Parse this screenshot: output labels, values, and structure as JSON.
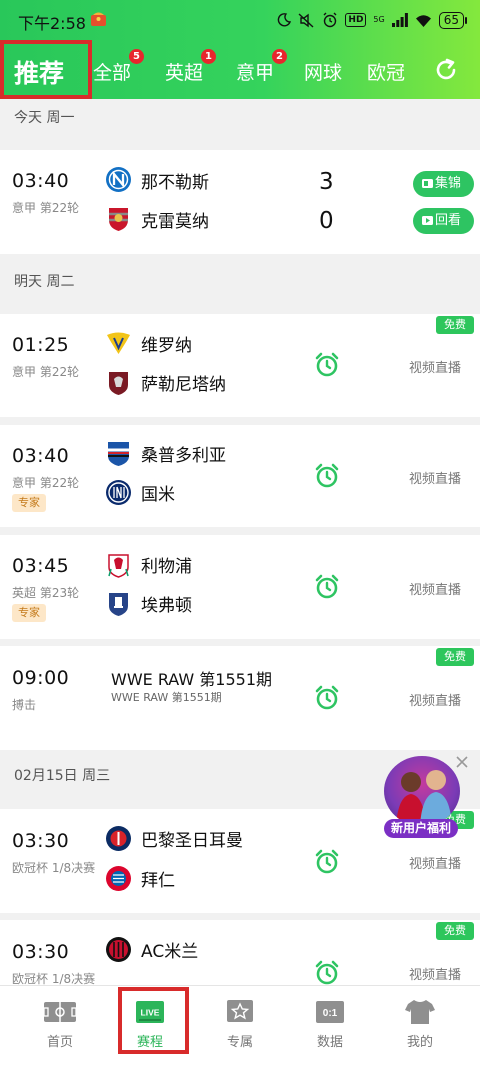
{
  "status_bar": {
    "time": "下午2:58",
    "network": "5G",
    "hd": "HD",
    "battery": "65"
  },
  "tabs": [
    {
      "label": "推荐",
      "badge": ""
    },
    {
      "label": "全部",
      "badge": "5"
    },
    {
      "label": "英超",
      "badge": "1"
    },
    {
      "label": "意甲",
      "badge": "2"
    },
    {
      "label": "网球",
      "badge": ""
    },
    {
      "label": "欧冠",
      "badge": ""
    }
  ],
  "sections": [
    {
      "label": "今天 周一"
    },
    {
      "label": "明天 周二"
    },
    {
      "label": "02月15日 周三"
    }
  ],
  "matches": [
    {
      "time": "03:40",
      "league": "意甲 第22轮",
      "home": "那不勒斯",
      "away": "克雷莫纳",
      "home_score": "3",
      "away_score": "0",
      "actions": [
        "集锦",
        "回看"
      ]
    },
    {
      "time": "01:25",
      "league": "意甲 第22轮",
      "home": "维罗纳",
      "away": "萨勒尼塔纳",
      "free": "免费",
      "live": "视频直播"
    },
    {
      "time": "03:40",
      "league": "意甲 第22轮",
      "expert": "专家",
      "home": "桑普多利亚",
      "away": "国米",
      "live": "视频直播"
    },
    {
      "time": "03:45",
      "league": "英超 第23轮",
      "expert": "专家",
      "home": "利物浦",
      "away": "埃弗顿",
      "live": "视频直播"
    },
    {
      "time": "09:00",
      "league": "搏击",
      "title": "WWE RAW 第1551期",
      "subtitle": "WWE RAW 第1551期",
      "free": "免费",
      "live": "视频直播"
    },
    {
      "time": "03:30",
      "league": "欧冠杯 1/8决赛",
      "home": "巴黎圣日耳曼",
      "away": "拜仁",
      "free": "免费",
      "live": "视频直播"
    },
    {
      "time": "03:30",
      "league": "欧冠杯 1/8决赛",
      "home": "AC米兰",
      "free": "免费",
      "live": "视频直播"
    }
  ],
  "promo": {
    "label": "新用户福利"
  },
  "bottom_nav": [
    {
      "label": "首页",
      "icon": "pitch-icon"
    },
    {
      "label": "赛程",
      "icon": "live-icon",
      "icon_text": "LIVE",
      "active": true
    },
    {
      "label": "专属",
      "icon": "star-icon"
    },
    {
      "label": "数据",
      "icon": "scoreboard-icon",
      "icon_text": "0:1"
    },
    {
      "label": "我的",
      "icon": "jersey-icon"
    }
  ],
  "colors": {
    "accent": "#2ec462",
    "highlight_border": "#d82b2b",
    "badge": "#e8262d"
  }
}
